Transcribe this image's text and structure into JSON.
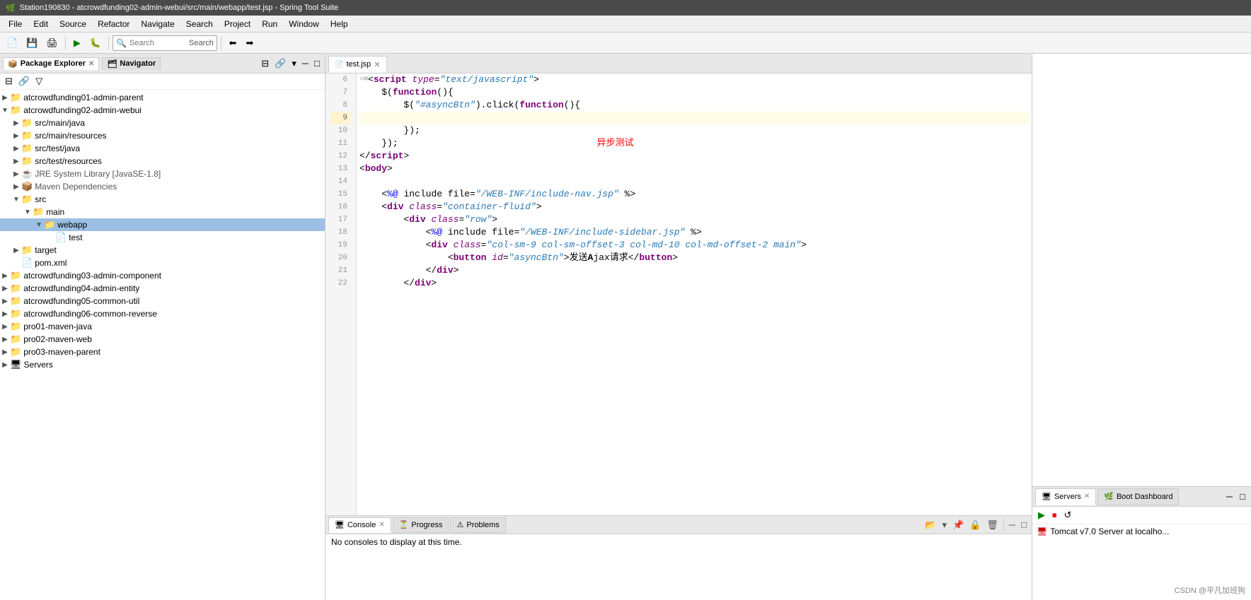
{
  "titlebar": {
    "text": "Station190830 - atcrowdfunding02-admin-webui/src/main/webapp/test.jsp - Spring Tool Suite",
    "icon": "🌿"
  },
  "menubar": {
    "items": [
      "File",
      "Edit",
      "Source",
      "Refactor",
      "Navigate",
      "Search",
      "Project",
      "Run",
      "Window",
      "Help"
    ]
  },
  "toolbar": {
    "search_placeholder": "Search",
    "search_label": "Search"
  },
  "left_panel": {
    "tabs": [
      {
        "label": "Package Explorer",
        "active": true,
        "icon": "📦"
      },
      {
        "label": "Navigator",
        "active": false,
        "icon": "🗂"
      }
    ],
    "tree": [
      {
        "indent": 0,
        "toggle": "▶",
        "icon": "📁",
        "label": "atcrowdfunding01-admin-parent",
        "type": "project"
      },
      {
        "indent": 0,
        "toggle": "▼",
        "icon": "📁",
        "label": "atcrowdfunding02-admin-webui",
        "type": "project",
        "expanded": true
      },
      {
        "indent": 1,
        "toggle": "▶",
        "icon": "📁",
        "label": "src/main/java",
        "type": "folder"
      },
      {
        "indent": 1,
        "toggle": "▶",
        "icon": "📁",
        "label": "src/main/resources",
        "type": "folder"
      },
      {
        "indent": 1,
        "toggle": "▶",
        "icon": "📁",
        "label": "src/test/java",
        "type": "folder"
      },
      {
        "indent": 1,
        "toggle": "▶",
        "icon": "📁",
        "label": "src/test/resources",
        "type": "folder"
      },
      {
        "indent": 1,
        "toggle": "▶",
        "icon": "☕",
        "label": "JRE System Library [JavaSE-1.8]",
        "type": "library"
      },
      {
        "indent": 1,
        "toggle": "▶",
        "icon": "📦",
        "label": "Maven Dependencies",
        "type": "library"
      },
      {
        "indent": 1,
        "toggle": "▼",
        "icon": "📁",
        "label": "src",
        "type": "folder",
        "expanded": true
      },
      {
        "indent": 2,
        "toggle": "▼",
        "icon": "📁",
        "label": "main",
        "type": "folder",
        "expanded": true
      },
      {
        "indent": 3,
        "toggle": "▼",
        "icon": "📁",
        "label": "webapp",
        "type": "folder",
        "highlighted": true
      },
      {
        "indent": 4,
        "toggle": " ",
        "icon": "📄",
        "label": "test",
        "type": "file"
      },
      {
        "indent": 1,
        "toggle": "▶",
        "icon": "📁",
        "label": "target",
        "type": "folder"
      },
      {
        "indent": 1,
        "toggle": " ",
        "icon": "📄",
        "label": "pom.xml",
        "type": "file"
      },
      {
        "indent": 0,
        "toggle": "▶",
        "icon": "📁",
        "label": "atcrowdfunding03-admin-component",
        "type": "project"
      },
      {
        "indent": 0,
        "toggle": "▶",
        "icon": "📁",
        "label": "atcrowdfunding04-admin-entity",
        "type": "project"
      },
      {
        "indent": 0,
        "toggle": "▶",
        "icon": "📁",
        "label": "atcrowdfunding05-common-util",
        "type": "project"
      },
      {
        "indent": 0,
        "toggle": "▶",
        "icon": "📁",
        "label": "atcrowdfunding06-common-reverse",
        "type": "project"
      },
      {
        "indent": 0,
        "toggle": "▶",
        "icon": "📁",
        "label": "pro01-maven-java",
        "type": "project"
      },
      {
        "indent": 0,
        "toggle": "▶",
        "icon": "📁",
        "label": "pro02-maven-web",
        "type": "project"
      },
      {
        "indent": 0,
        "toggle": "▶",
        "icon": "📁",
        "label": "pro03-maven-parent",
        "type": "project"
      },
      {
        "indent": 0,
        "toggle": "▶",
        "icon": "🖥",
        "label": "Servers",
        "type": "project"
      }
    ]
  },
  "editor": {
    "tabs": [
      {
        "label": "test.jsp",
        "active": true,
        "icon": "📄",
        "modified": false
      }
    ],
    "lines": [
      {
        "num": 6,
        "fold": "○",
        "content": [
          {
            "type": "fold",
            "text": "⊖"
          },
          {
            "type": "plain",
            "text": "<"
          },
          {
            "type": "kw",
            "text": "script"
          },
          {
            "type": "plain",
            "text": " "
          },
          {
            "type": "attr",
            "text": "type"
          },
          {
            "type": "plain",
            "text": "="
          },
          {
            "type": "attrval",
            "text": "\"text/javascript\""
          },
          {
            "type": "plain",
            "text": ">"
          }
        ]
      },
      {
        "num": 7,
        "content": [
          {
            "type": "plain",
            "text": "    "
          },
          {
            "type": "plain",
            "text": "$"
          },
          {
            "type": "plain",
            "text": "("
          },
          {
            "type": "kw",
            "text": "function"
          },
          {
            "type": "plain",
            "text": "(){"
          }
        ]
      },
      {
        "num": 8,
        "content": [
          {
            "type": "plain",
            "text": "        "
          },
          {
            "type": "plain",
            "text": "$("
          },
          {
            "type": "str",
            "text": "\"#asyncBtn\""
          },
          {
            "type": "plain",
            "text": ")"
          },
          {
            "type": "plain",
            "text": ".click("
          },
          {
            "type": "kw",
            "text": "function"
          },
          {
            "type": "plain",
            "text": "(){"
          }
        ]
      },
      {
        "num": 9,
        "current": true,
        "content": []
      },
      {
        "num": 10,
        "content": [
          {
            "type": "plain",
            "text": "        "
          },
          {
            "type": "plain",
            "text": "});"
          }
        ]
      },
      {
        "num": 11,
        "content": [
          {
            "type": "plain",
            "text": "    "
          },
          {
            "type": "plain",
            "text": "});"
          },
          {
            "type": "plain",
            "text": "                                    "
          },
          {
            "type": "red",
            "text": "异步测试"
          }
        ]
      },
      {
        "num": 12,
        "content": [
          {
            "type": "plain",
            "text": "</"
          },
          {
            "type": "kw",
            "text": "script"
          },
          {
            "type": "plain",
            "text": ">"
          }
        ]
      },
      {
        "num": 13,
        "content": [
          {
            "type": "plain",
            "text": "<"
          },
          {
            "type": "kw",
            "text": "body"
          },
          {
            "type": "plain",
            "text": ">"
          }
        ]
      },
      {
        "num": 14,
        "content": []
      },
      {
        "num": 15,
        "content": [
          {
            "type": "plain",
            "text": "    "
          },
          {
            "type": "plain",
            "text": "<"
          },
          {
            "type": "tag",
            "text": "%@"
          },
          {
            "type": "plain",
            "text": " include file="
          },
          {
            "type": "attrval",
            "text": "\""
          },
          {
            "type": "attrval",
            "text": "/WEB-INF/include-nav.jsp"
          },
          {
            "type": "attrval",
            "text": "\""
          },
          {
            "type": "plain",
            "text": " %>"
          }
        ]
      },
      {
        "num": 16,
        "content": [
          {
            "type": "plain",
            "text": "    <"
          },
          {
            "type": "kw",
            "text": "div"
          },
          {
            "type": "plain",
            "text": " "
          },
          {
            "type": "attr",
            "text": "class"
          },
          {
            "type": "plain",
            "text": "="
          },
          {
            "type": "attrval",
            "text": "\"container-fluid\""
          },
          {
            "type": "plain",
            "text": ">"
          }
        ]
      },
      {
        "num": 17,
        "content": [
          {
            "type": "plain",
            "text": "        <"
          },
          {
            "type": "kw",
            "text": "div"
          },
          {
            "type": "plain",
            "text": " "
          },
          {
            "type": "attr",
            "text": "class"
          },
          {
            "type": "plain",
            "text": "="
          },
          {
            "type": "attrval",
            "text": "\"row\""
          },
          {
            "type": "plain",
            "text": ">"
          }
        ]
      },
      {
        "num": 18,
        "content": [
          {
            "type": "plain",
            "text": "            <"
          },
          {
            "type": "tag",
            "text": "%@"
          },
          {
            "type": "plain",
            "text": " include file="
          },
          {
            "type": "attrval",
            "text": "\""
          },
          {
            "type": "attrval",
            "text": "/WEB-INF/include-sidebar.jsp"
          },
          {
            "type": "attrval",
            "text": "\""
          },
          {
            "type": "plain",
            "text": " %>"
          }
        ]
      },
      {
        "num": 19,
        "content": [
          {
            "type": "plain",
            "text": "            <"
          },
          {
            "type": "kw",
            "text": "div"
          },
          {
            "type": "plain",
            "text": " "
          },
          {
            "type": "attr",
            "text": "class"
          },
          {
            "type": "plain",
            "text": "="
          },
          {
            "type": "attrval",
            "text": "\"col-sm-9 col-sm-offset-3 col-md-10 col-md-offset-2 main\""
          },
          {
            "type": "plain",
            "text": ">"
          }
        ]
      },
      {
        "num": 20,
        "content": [
          {
            "type": "plain",
            "text": "                <"
          },
          {
            "type": "kw",
            "text": "button"
          },
          {
            "type": "plain",
            "text": " "
          },
          {
            "type": "attr",
            "text": "id"
          },
          {
            "type": "plain",
            "text": "="
          },
          {
            "type": "attrval",
            "text": "\"asyncBtn\""
          },
          {
            "type": "plain",
            "text": ">发送"
          },
          {
            "type": "bold",
            "text": "A"
          },
          {
            "type": "plain",
            "text": "jax请求</"
          },
          {
            "type": "kw",
            "text": "button"
          },
          {
            "type": "plain",
            "text": ">"
          }
        ]
      },
      {
        "num": 21,
        "content": [
          {
            "type": "plain",
            "text": "            </"
          },
          {
            "type": "kw",
            "text": "div"
          },
          {
            "type": "plain",
            "text": ">"
          }
        ]
      },
      {
        "num": 22,
        "content": [
          {
            "type": "plain",
            "text": "        </"
          },
          {
            "type": "kw",
            "text": "div"
          },
          {
            "type": "plain",
            "text": ">"
          }
        ]
      }
    ]
  },
  "bottom_panel": {
    "tabs": [
      {
        "label": "Console",
        "active": true,
        "icon": "🖥",
        "close": true
      },
      {
        "label": "Progress",
        "active": false,
        "icon": "⏳"
      },
      {
        "label": "Problems",
        "active": false,
        "icon": "⚠"
      }
    ],
    "console_text": "No consoles to display at this time."
  },
  "right_panel": {
    "tabs": [
      {
        "label": "Servers",
        "active": true,
        "icon": "🖥"
      },
      {
        "label": "Boot Dashboard",
        "active": false,
        "icon": "🌿"
      }
    ],
    "servers": [
      {
        "icon": "🖥",
        "label": "Tomcat v7.0 Server at localho..."
      }
    ]
  },
  "watermark": "CSDN @平凡加班狗"
}
